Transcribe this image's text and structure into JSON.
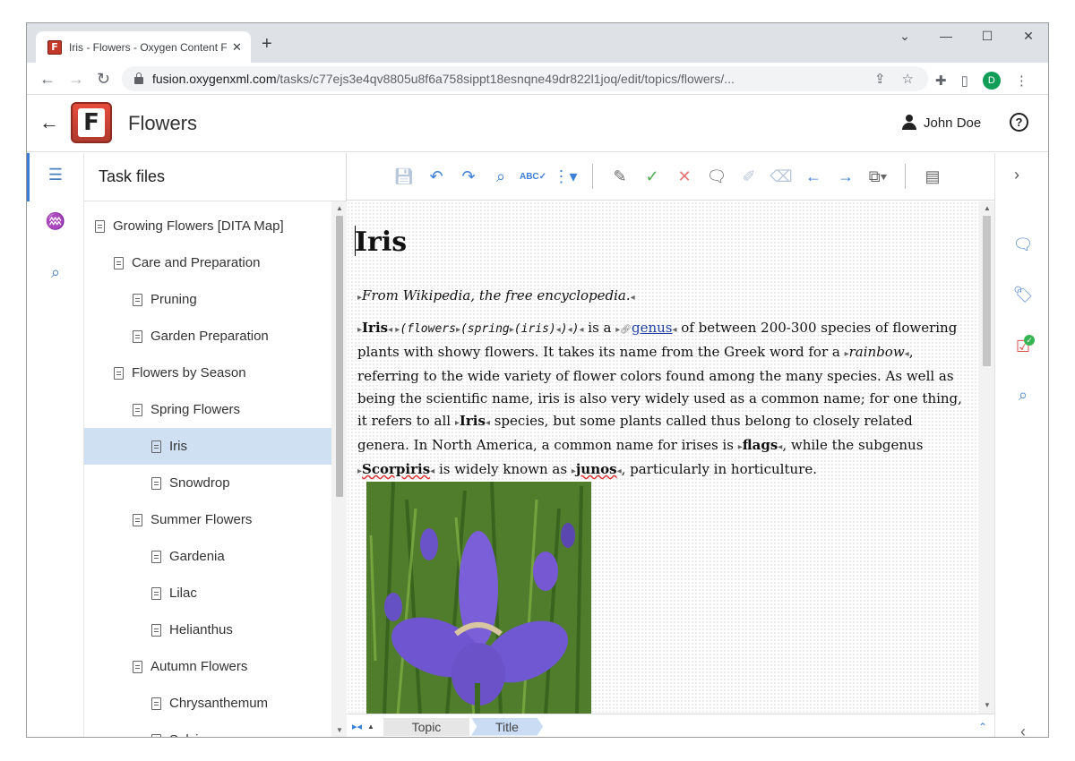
{
  "browser": {
    "tab_title": "Iris - Flowers - Oxygen Content F",
    "tab_close": "✕",
    "new_tab": "+",
    "url_main": "fusion.oxygenxml.com",
    "url_rest": "/tasks/c77ejs3e4qv8805u8f6a758sippt18esnqne49dr822l1joq/edit/topics/flowers/...",
    "profile_initial": "D",
    "win_minimize": "⌄",
    "win_min": "—",
    "win_max": "☐",
    "win_close": "✕",
    "nav_back": "←",
    "nav_forward": "→",
    "nav_reload": "↻"
  },
  "app": {
    "back": "←",
    "logo_letter": "F",
    "title": "Flowers",
    "user_name": "John Doe",
    "help": "?"
  },
  "panel": {
    "title": "Task files",
    "items": [
      {
        "label": "Growing Flowers [DITA Map]",
        "indent": 0
      },
      {
        "label": "Care and Preparation",
        "indent": 1
      },
      {
        "label": "Pruning",
        "indent": 2
      },
      {
        "label": "Garden Preparation",
        "indent": 2
      },
      {
        "label": "Flowers by Season",
        "indent": 1
      },
      {
        "label": "Spring Flowers",
        "indent": 2
      },
      {
        "label": "Iris",
        "indent": 3,
        "selected": true
      },
      {
        "label": "Snowdrop",
        "indent": 3
      },
      {
        "label": "Summer Flowers",
        "indent": 2
      },
      {
        "label": "Gardenia",
        "indent": 3
      },
      {
        "label": "Lilac",
        "indent": 3
      },
      {
        "label": "Helianthus",
        "indent": 3
      },
      {
        "label": "Autumn Flowers",
        "indent": 2
      },
      {
        "label": "Chrysanthemum",
        "indent": 3
      },
      {
        "label": "Salvia",
        "indent": 3
      }
    ]
  },
  "doc": {
    "title": "Iris",
    "shortdesc": "From Wikipedia, the free encyclopedia.",
    "p_iris": "Iris",
    "p_index": "(flowers",
    "p_index2": "(spring",
    "p_index3": "(iris)",
    "p_index4": ")",
    "p_index5": ")",
    "p_isa": " is a ",
    "p_genus": "genus",
    "p_t1": " of between 200-300 species of flowering plants with showy flowers. It takes its name from the Greek word for a ",
    "p_rainbow": "rainbow",
    "p_t2": ", referring to the wide variety of flower colors found among the many species. As well as being the scientific name, iris is also very widely used as a common name; for one thing, it refers to all ",
    "p_iris2": "Iris",
    "p_t3": " species, but some plants called thus belong to closely related genera. In North America, a common name for irises is ",
    "p_flags": "flags",
    "p_t4": ", while the subgenus ",
    "p_scorpiris": "Scorpiris",
    "p_t5": " is widely known as ",
    "p_junos": "junos",
    "p_t6": ", particularly in horticulture."
  },
  "breadcrumbs": {
    "topic": "Topic",
    "title": "Title"
  },
  "colors": {
    "accent": "#3d7dd8",
    "selection": "#cfe0f2",
    "logo_red": "#c0392b"
  }
}
